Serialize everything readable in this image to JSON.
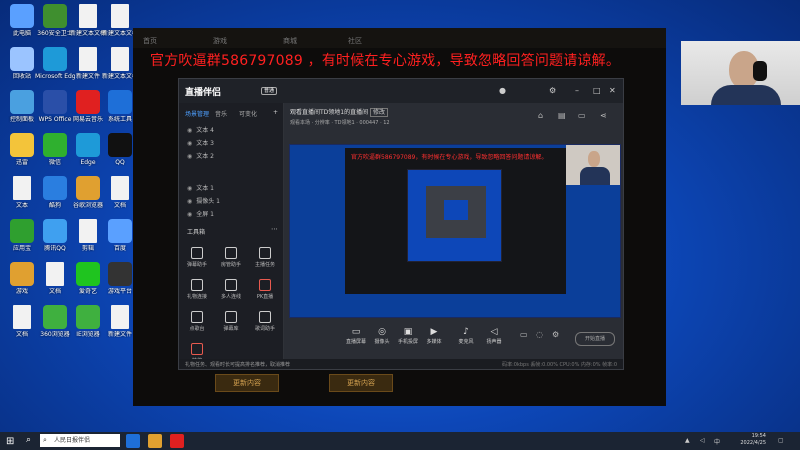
{
  "banner": "官方吹逼群586797089 ，有时候在专心游戏，导致忽略回答问题请谅解。",
  "desktop_icons": [
    {
      "label": "此电脑",
      "color": "#5aa0ff"
    },
    {
      "label": "360安全卫士",
      "color": "#3f8f2f"
    },
    {
      "label": "新建文本文档",
      "color": "#f2f2f2"
    },
    {
      "label": "新建文本文档",
      "color": "#f2f2f2"
    },
    {
      "label": "回收站",
      "color": "#9bc4ff"
    },
    {
      "label": "Microsoft Edge",
      "color": "#1e9ad8"
    },
    {
      "label": "新建文件",
      "color": "#f2f2f2"
    },
    {
      "label": "新建文本文档",
      "color": "#f2f2f2"
    },
    {
      "label": "控制面板",
      "color": "#4aa0e0"
    },
    {
      "label": "WPS Office",
      "color": "#2a4fa8"
    },
    {
      "label": "网易云音乐",
      "color": "#e02020"
    },
    {
      "label": "系统工具",
      "color": "#1e6fd8"
    },
    {
      "label": "迅雷",
      "color": "#f3c43a"
    },
    {
      "label": "微信",
      "color": "#2fb02f"
    },
    {
      "label": "Edge",
      "color": "#1e9ad8"
    },
    {
      "label": "QQ",
      "color": "#111"
    },
    {
      "label": "文本",
      "color": "#f2f2f2"
    },
    {
      "label": "酷狗",
      "color": "#2a7ee0"
    },
    {
      "label": "谷歌浏览器",
      "color": "#e0a030"
    },
    {
      "label": "文档",
      "color": "#f2f2f2"
    },
    {
      "label": "应用宝",
      "color": "#2f9f2f"
    },
    {
      "label": "腾讯QQ",
      "color": "#3fa0f0"
    },
    {
      "label": "剪辑",
      "color": "#f2f2f2"
    },
    {
      "label": "百度",
      "color": "#5aa0ff"
    },
    {
      "label": "游戏",
      "color": "#e0a030"
    },
    {
      "label": "文档",
      "color": "#f2f2f2"
    },
    {
      "label": "爱奇艺",
      "color": "#1fc41f"
    },
    {
      "label": "游戏平台",
      "color": "#333"
    },
    {
      "label": "文档",
      "color": "#f2f2f2"
    },
    {
      "label": "360浏览器",
      "color": "#3fb03f"
    },
    {
      "label": "IE浏览器",
      "color": "#3fb03f"
    },
    {
      "label": "新建文件",
      "color": "#f2f2f2"
    }
  ],
  "game": {
    "menu": [
      "首页",
      "游戏",
      "商城",
      "社区"
    ],
    "tiles": [
      "更新内容",
      "更新内容"
    ]
  },
  "app": {
    "brand": "直播伴侣",
    "badge": "普通",
    "left_tabs": [
      "场景管理",
      "音乐",
      "可变化"
    ],
    "scenes": [
      "文本 4",
      "文本 3",
      "文本 2",
      "文本 1",
      "摄像头 1",
      "全屏 1"
    ],
    "toolbox_title": "工具箱",
    "tools": [
      "弹幕助手",
      "房管助手",
      "主播任务",
      "礼物连接",
      "多人连线",
      "PK直播",
      "点歌台",
      "弹幕库",
      "歌词助手",
      "抽奖",
      "更多"
    ],
    "title": "观看直播间TD领地1的直播间",
    "title_tag": "修改",
    "info": "观看本场 · 分辨率 · TD领地1 · 000447 · 12",
    "bottom_tools": [
      "直播屏幕",
      "摄像头",
      "手机投屏",
      "多媒体",
      "麦克风",
      "扬声器"
    ],
    "start_label": "开始直播",
    "status": "礼物任务、观看时长可提高排名推荐，取消推荐",
    "status_right": "码率:0kbps  丢帧:0.00%  CPU:0%  内存:0%  帧率:0"
  },
  "nested_banner": "官方吹逼群586797089，有时候在专心游戏，导致忽略回答问题请谅解。",
  "taskbar": {
    "search_text": "人民日报伴侣",
    "time": "19:54",
    "date": "2022/4/25"
  }
}
